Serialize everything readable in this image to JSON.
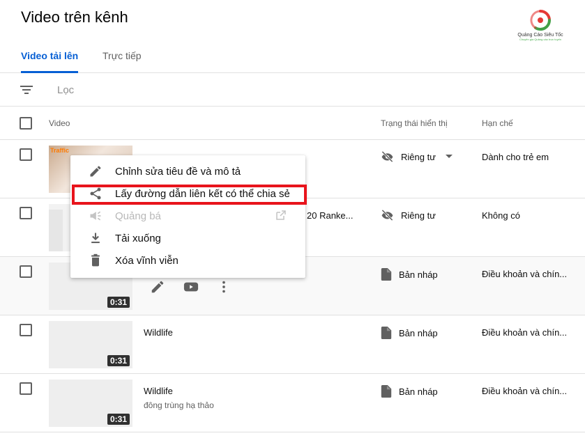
{
  "header": {
    "title": "Video trên kênh"
  },
  "logo": {
    "name": "Quảng Cáo Siêu Tốc",
    "tagline": "Chuyên gia Quảng cáo trực tuyến"
  },
  "tabs": [
    {
      "label": "Video tải lên",
      "active": true
    },
    {
      "label": "Trực tiếp",
      "active": false
    }
  ],
  "filter": {
    "placeholder": "Lọc",
    "icon": "filter-icon"
  },
  "table": {
    "columns": {
      "video": "Video",
      "visibility": "Trạng thái hiển thị",
      "restrictions": "Hạn chế"
    },
    "rows": [
      {
        "title": "",
        "description": "",
        "duration": "",
        "visibility": "Riêng tư",
        "visibility_icon": "eye-off-icon",
        "restriction": "Dành cho trẻ em",
        "thumb_text": "Traffic"
      },
      {
        "title": "20 Ranke...",
        "description": "",
        "duration": "",
        "visibility": "Riêng tư",
        "visibility_icon": "eye-off-icon",
        "restriction": "Không có"
      },
      {
        "title": "",
        "description": "",
        "duration": "0:31",
        "visibility": "Bản nháp",
        "visibility_icon": "draft-icon",
        "restriction": "Điều khoản và chín..."
      },
      {
        "title": "Wildlife",
        "description": "",
        "duration": "0:31",
        "visibility": "Bản nháp",
        "visibility_icon": "draft-icon",
        "restriction": "Điều khoản và chín..."
      },
      {
        "title": "Wildlife",
        "description": "đông trùng hạ thảo",
        "duration": "0:31",
        "visibility": "Bản nháp",
        "visibility_icon": "draft-icon",
        "restriction": "Điều khoản và chín..."
      }
    ]
  },
  "context_menu": {
    "items": [
      {
        "label": "Chỉnh sửa tiêu đề và mô tả",
        "icon": "pencil-icon",
        "enabled": true
      },
      {
        "label": "Lấy đường dẫn liên kết có thể chia sẻ",
        "icon": "share-icon",
        "enabled": true,
        "highlighted": true
      },
      {
        "label": "Quảng bá",
        "icon": "megaphone-icon",
        "enabled": false
      },
      {
        "label": "Tải xuống",
        "icon": "download-icon",
        "enabled": true
      },
      {
        "label": "Xóa vĩnh viễn",
        "icon": "trash-icon",
        "enabled": true
      }
    ]
  },
  "colors": {
    "accent": "#065fd4",
    "highlight": "#e8141c",
    "text_secondary": "#606060"
  }
}
